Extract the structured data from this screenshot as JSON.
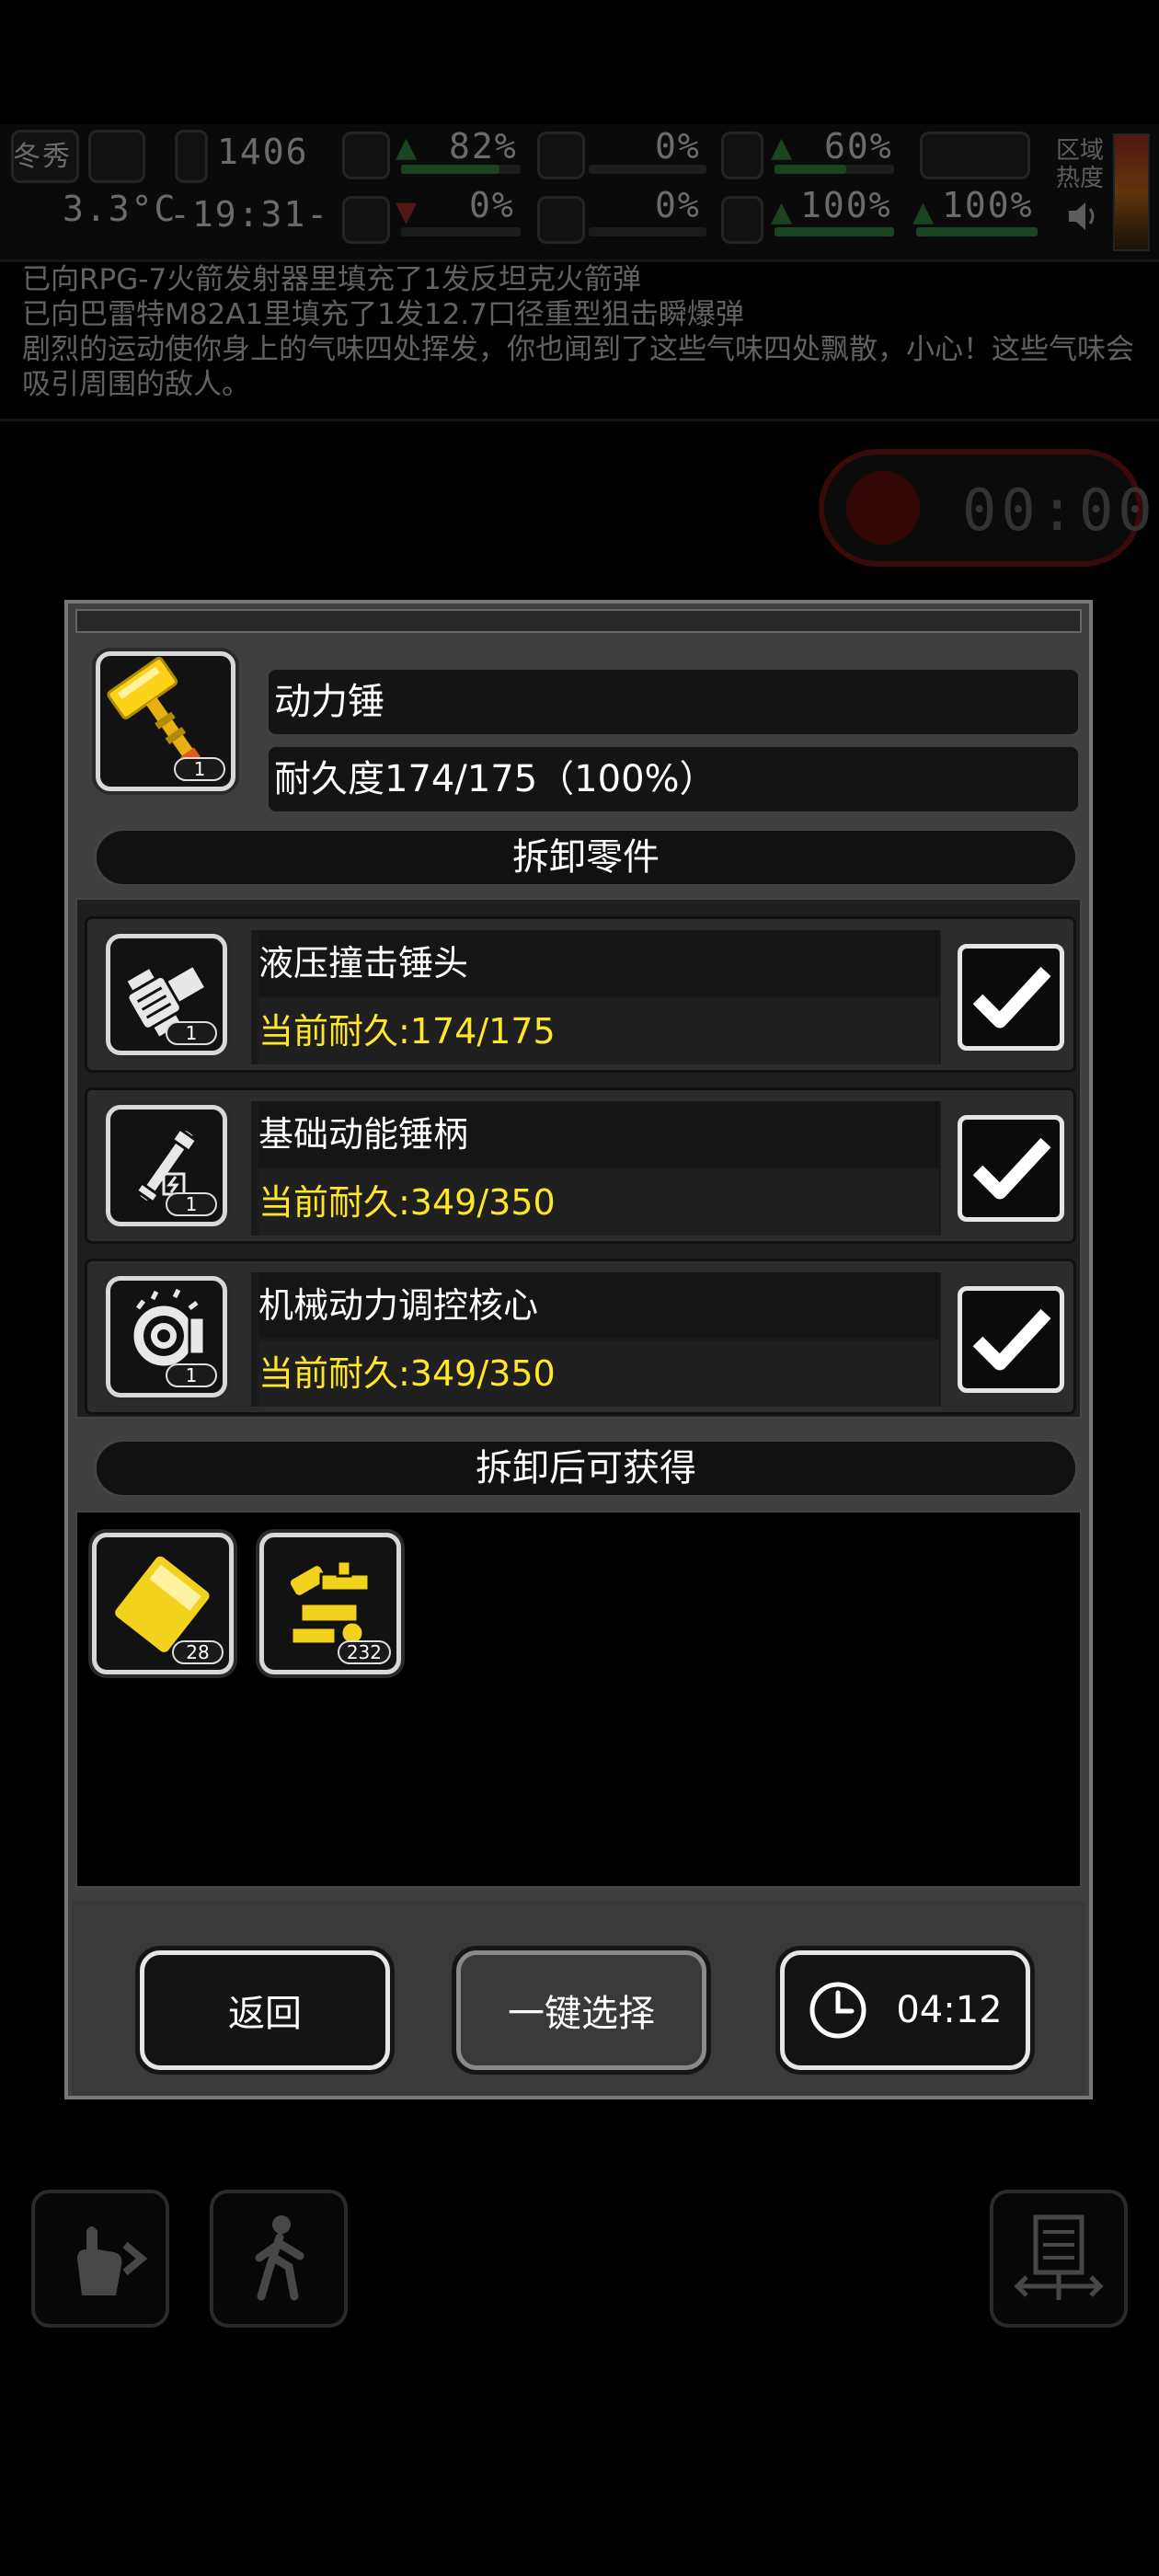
{
  "hud": {
    "season": "冬秀",
    "temperature": "3.3°C",
    "day_counter": "1406",
    "time": "-19:31-",
    "stats_top": [
      {
        "value": "82%",
        "color": "#3fa34d"
      },
      {
        "value": "0%",
        "color": "#3fa34d"
      },
      {
        "value": "60%",
        "color": "#3fa34d"
      }
    ],
    "stats_bottom": [
      {
        "value": "0%",
        "color": "#c0392b"
      },
      {
        "value": "0%",
        "color": "#c0392b"
      },
      {
        "value": "100%",
        "color": "#3fa34d"
      },
      {
        "value": "100%",
        "color": "#3fa34d"
      }
    ],
    "zone_heat_label_1": "区域",
    "zone_heat_label_2": "热度"
  },
  "log": {
    "lines": [
      "已向RPG-7火箭发射器里填充了1发反坦克火箭弹",
      "已向巴雷特M82A1里填充了1发12.7口径重型狙击瞬爆弹",
      "剧烈的运动使你身上的气味四处挥发，你也闻到了这些气味四处飘散，小心！这些气味会吸引周围的敌人。"
    ]
  },
  "timer": {
    "text": "00:00"
  },
  "dialog": {
    "item": {
      "icon": "power-hammer-icon",
      "count": "1",
      "name": "动力锤",
      "durability": "耐久度174/175（100%）"
    },
    "parts_header": "拆卸零件",
    "parts": [
      {
        "icon": "hydraulic-hammer-head-icon",
        "count": "1",
        "name": "液压撞击锤头",
        "durability": "当前耐久:174/175",
        "checked": true
      },
      {
        "icon": "kinetic-handle-icon",
        "count": "1",
        "name": "基础动能锤柄",
        "durability": "当前耐久:349/350",
        "checked": true
      },
      {
        "icon": "mechanical-core-icon",
        "count": "1",
        "name": "机械动力调控核心",
        "durability": "当前耐久:349/350",
        "checked": true
      }
    ],
    "loot_header": "拆卸后可获得",
    "loot": [
      {
        "icon": "metal-plate-icon",
        "count": "28"
      },
      {
        "icon": "mechanical-parts-icon",
        "count": "232"
      }
    ],
    "buttons": {
      "back": "返回",
      "select_all": "一键选择",
      "timer": "04:12"
    }
  },
  "colors": {
    "accent_yellow": "#ffe62a",
    "panel": "#3f3f3f",
    "check_border": "#e6e6e6"
  }
}
